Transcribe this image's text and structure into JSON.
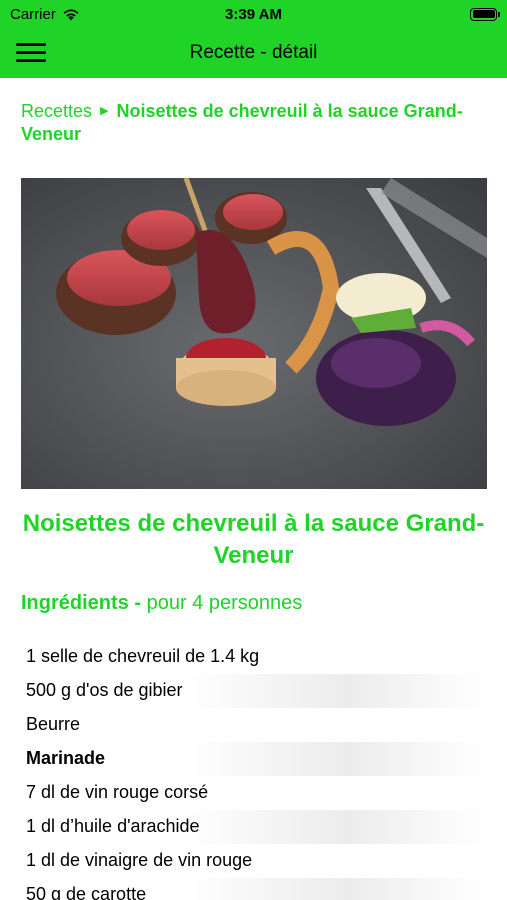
{
  "status": {
    "carrier": "Carrier",
    "time": "3:39 AM",
    "battery_level": 1.0
  },
  "nav": {
    "title": "Recette - détail",
    "menu_icon": "hamburger-menu-icon"
  },
  "breadcrumb": {
    "parent": "Recettes",
    "current": "Noisettes de chevreuil à la sauce Grand-Veneur"
  },
  "recipe": {
    "title": "Noisettes de chevreuil à la sauce Grand-Veneur",
    "image_alt": "",
    "ingredients_label": "Ingrédients -",
    "servings": "pour 4 personnes",
    "ingredients": [
      "1 selle de chevreuil de 1.4 kg",
      "500 g d'os de gibier",
      "Beurre",
      "Marinade",
      "7 dl de vin rouge corsé",
      "1 dl d’huile d'arachide",
      "1 dl de vinaigre de vin rouge",
      "50 g de carotte"
    ]
  },
  "colors": {
    "accent": "#1fd327",
    "text": "#000000",
    "row_shade": "#ececec"
  }
}
